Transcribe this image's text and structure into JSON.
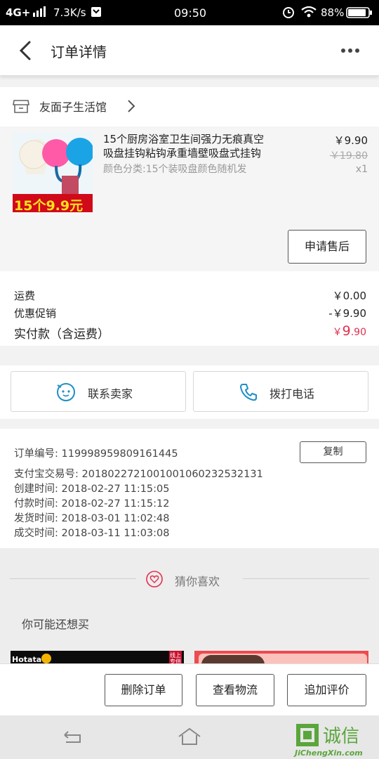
{
  "status_bar": {
    "network": "4G+",
    "speed": "7.3K/s",
    "time": "09:50",
    "battery": "88%"
  },
  "header": {
    "title": "订单详情"
  },
  "shop": {
    "name": "友面子生活馆"
  },
  "product": {
    "title_line1": "15个厨房浴室卫生间强力无痕真空",
    "title_line2": "吸盘挂钩粘钩承重墙壁吸盘式挂钩",
    "spec": "颜色分类:15个装吸盘颜色随机发",
    "price": "￥9.90",
    "original_price": "￥19.80",
    "quantity": "x1",
    "thumb_label": "15个9.9元",
    "after_sale_label": "申请售后"
  },
  "fees": {
    "shipping_label": "运费",
    "shipping_value": "￥0.00",
    "discount_label": "优惠促销",
    "discount_value": "-￥9.90",
    "paid_label": "实付款（含运费）",
    "paid_currency": "￥",
    "paid_int": "9",
    "paid_dec": ".90"
  },
  "contact": {
    "seller_label": "联系卖家",
    "phone_label": "拨打电话"
  },
  "order_info": {
    "order_no": "订单编号: 119998959809161445",
    "alipay_no": "支付宝交易号: 2018022721001001060232532131",
    "created": "创建时间: 2018-02-27 11:15:05",
    "paid": "付款时间: 2018-02-27 11:15:12",
    "shipped": "发货时间: 2018-03-01 11:02:48",
    "completed": "成交时间: 2018-03-11 11:03:08",
    "copy_label": "复制"
  },
  "recommend": {
    "guess_label": "猜你喜欢",
    "maybe_label": "你可能还想买",
    "card1_brand": "Hotata",
    "card1_tag": "线上专供"
  },
  "actions": {
    "delete_label": "删除订单",
    "logistics_label": "查看物流",
    "review_label": "追加评价"
  },
  "watermark": {
    "text": "JiChengXin.com",
    "chars": "集诚信"
  },
  "colors": {
    "accent": "#e0304d",
    "dark_text": "#222222"
  }
}
